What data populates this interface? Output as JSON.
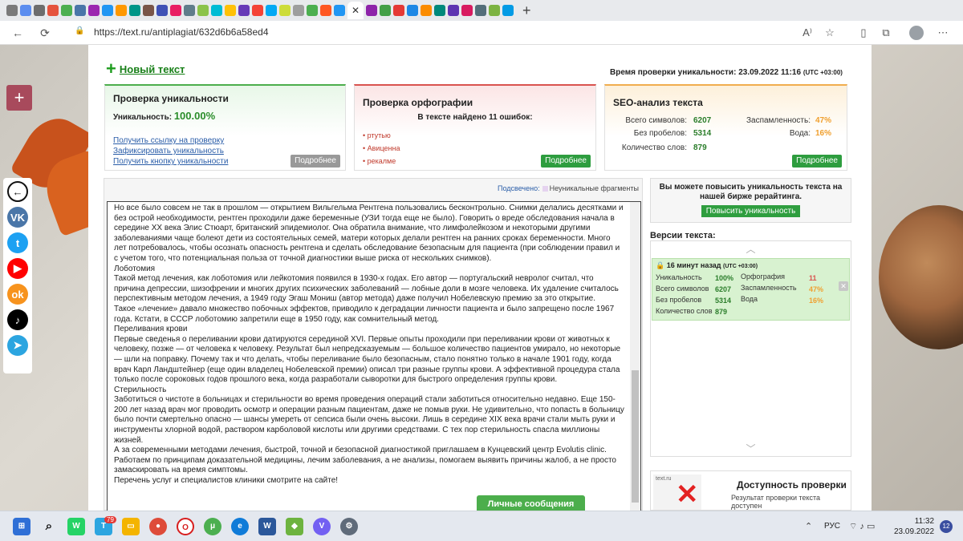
{
  "browser": {
    "url": "https://text.ru/antiplagiat/632d6b6a58ed4",
    "close_tab": "✕",
    "new_tab": "+",
    "back": "←",
    "reload": "⟳",
    "lock": "🔒",
    "read_aloud": "A⁾",
    "favorite": "☆",
    "minimize": "—"
  },
  "page": {
    "new_text": "Новый текст",
    "check_time": "Время проверки уникальности: 23.09.2022 11:16",
    "check_time_tz": "(UTC +03:00)",
    "uniqueness": {
      "title": "Проверка уникальности",
      "label": "Уникальность:",
      "value": "100.00%",
      "links": [
        "Получить ссылку на проверку",
        "Зафиксировать уникальность",
        "Получить кнопку уникальности"
      ],
      "more": "Подробнее"
    },
    "spelling": {
      "title": "Проверка орфографии",
      "found": "В тексте найдено 11 ошибок:",
      "errors": [
        "• ртутью",
        "• Авиценна",
        "• рекалме"
      ],
      "more": "Подробнее"
    },
    "seo": {
      "title": "SEO-анализ текста",
      "chars_label": "Всего символов:",
      "chars": "6207",
      "nospace_label": "Без пробелов:",
      "nospace": "5314",
      "words_label": "Количество слов:",
      "words": "879",
      "spam_label": "Заспамленность:",
      "spam": "47%",
      "water_label": "Вода:",
      "water": "16%",
      "more": "Подробнее"
    },
    "highlight": {
      "label": "Подсвечено:",
      "fragments": "Неуникальные фрагменты"
    },
    "editor_text": [
      "Но все было совсем не так в прошлом — открытием Вильгельма Рентгена пользовались бесконтрольно. Снимки делались десятками и без острой необходимости, рентген проходили даже беременные (УЗИ тогда еще не было). Говорить о вреде обследования начала в середине XX века Элис Стюарт, британский эпидемиолог. Она обратила внимание, что лимфолейкозом и некоторыми другими заболеваниями чаще болеют дети из состоятельных семей, матери которых делали рентген на ранних сроках беременности. Много лет потребовалось, чтобы осознать опасность рентгена и сделать обследование безопасным для пациента (при соблюдении правил и с учетом того, что потенциальная польза от точной диагностики выше риска от нескольких снимков).",
      "Лоботомия",
      "Такой метод лечения, как лоботомия или лейкотомия появился в 1930-х годах. Его автор — португальский невролог считал, что причина депрессии, шизофрении и многих других психических заболеваний — лобные доли в мозге человека. Их удаление считалось перспективным методом лечения, а 1949 году Эгаш Мониш (автор метода) даже получил Нобелевскую премию за это открытие.",
      " ",
      "Такое «лечение» давало множество побочных эффектов, приводило к деградации личности пациента и было запрещено после 1967 года. Кстати, в СССР лоботомию запретили еще в 1950 году, как сомнительный метод.",
      "Переливания крови",
      "Первые сведенья о переливании крови датируются серединой XVI. Первые опыты проходили при переливании крови от животных к человеку, позже — от человека к человеку. Результат был непредсказуемым — большое количество пациентов умирало, но некоторые — шли на поправку. Почему так и что делать, чтобы переливание было безопасным, стало понятно только в начале 1901 году, когда врач Карл Ландштейнер (еще один владелец Нобелевской премии) описал три разные группы крови. А эффективной процедура стала только после сороковых годов прошлого века, когда разработали сыворотки для быстрого определения группы крови.",
      "Стерильность",
      "Заботиться о чистоте в больницах и стерильности во время проведения операций стали заботиться относительно недавно. Еще 150-200 лет назад врач мог проводить осмотр и операции разным пациентам, даже не помыв руки. Не удивительно, что попасть в больницу было почти смертельно опасно — шансы умереть от сепсиса были очень высоки. Лишь в середине XIX века врачи стали мыть руки и инструменты хлорной водой, раствором карболовой кислоты или другими средствами. С тех пор стерильность спасла миллионы жизней.",
      "А за современными методами лечения, быстрой, точной и безопасной диагностикой приглашаем в Кунцевский центр Evolutis clinic. Работаем по принципам доказательной медицины, лечим заболевания, а не анализы, помогаем выявить причины жалоб, а не просто замаскировать на время симптомы.",
      "Перечень услуг и специалистов клиники смотрите на сайте!"
    ],
    "messages_button": "Личные сообщения",
    "sidebar": {
      "bump_text": "Вы можете повысить уникальность текста на нашей бирже рерайтинга.",
      "bump_button": "Повысить уникальность",
      "versions_title": "Версии текста:",
      "version": {
        "time": "16 минут назад",
        "tz": "(UTC +03:00)",
        "uniq_label": "Уникальность",
        "uniq": "100%",
        "spell_label": "Орфография",
        "spell": "11",
        "chars_label": "Всего символов",
        "chars": "6207",
        "spam_label": "Заспамленность",
        "spam": "47%",
        "nospace_label": "Без пробелов",
        "nospace": "5314",
        "water_label": "Вода",
        "water": "16%",
        "words_label": "Количество слов",
        "words": "879",
        "lock": "🔒",
        "delete": "✕"
      },
      "up": "︿",
      "down": "﹀",
      "access_title": "Доступность проверки",
      "access_sub": "Результат проверки текста доступен",
      "access_x": "✕",
      "access_logo": "text.ru"
    }
  },
  "social": [
    "←",
    "VK",
    "t",
    "▶",
    "ok",
    "♪",
    "➤"
  ],
  "social_icons": [
    "back-icon",
    "vk-icon",
    "twitter-icon",
    "youtube-icon",
    "odnoklassniki-icon",
    "tiktok-icon",
    "telegram-icon"
  ],
  "social_colors": [
    "#111111",
    "#4a76a8",
    "#1da1f2",
    "#ff0000",
    "#f7931e",
    "#000000",
    "#2ca5e0"
  ],
  "plus_widget": "+",
  "taskbar": {
    "lang": "РУС",
    "tray": "⌃  ◫ ♪ ▭",
    "time": "11:32",
    "date": "23.09.2022",
    "notifications": "12",
    "badge": "79"
  }
}
